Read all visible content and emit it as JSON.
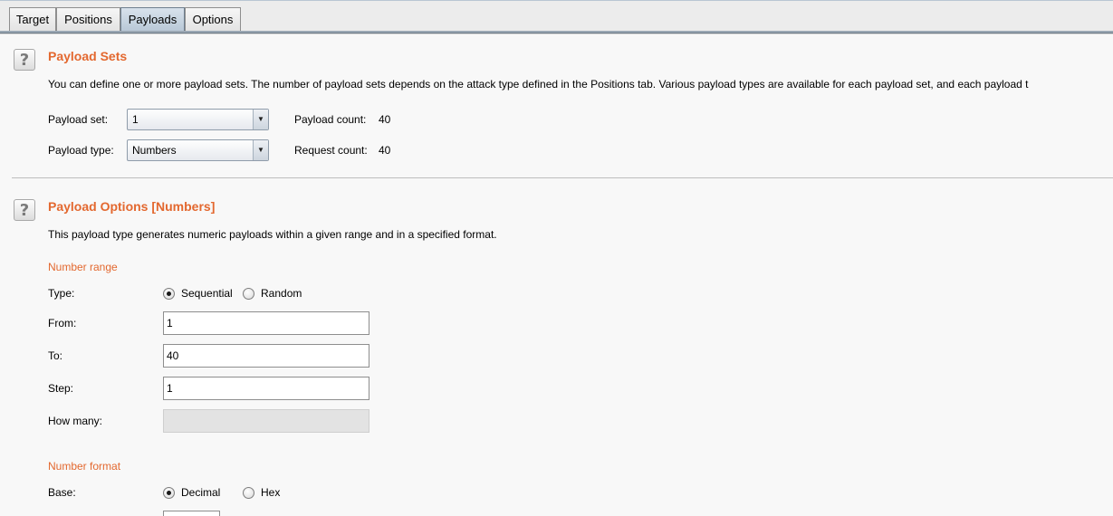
{
  "tabs": [
    {
      "label": "Target",
      "active": false
    },
    {
      "label": "Positions",
      "active": false
    },
    {
      "label": "Payloads",
      "active": true
    },
    {
      "label": "Options",
      "active": false
    }
  ],
  "payload_sets": {
    "title": "Payload Sets",
    "description": "You can define one or more payload sets. The number of payload sets depends on the attack type defined in the Positions tab. Various payload types are available for each payload set, and each payload t",
    "payload_set_label": "Payload set:",
    "payload_set_value": "1",
    "payload_type_label": "Payload type:",
    "payload_type_value": "Numbers",
    "payload_count_label": "Payload count:",
    "payload_count_value": "40",
    "request_count_label": "Request count:",
    "request_count_value": "40",
    "help_icon": "help-icon"
  },
  "payload_options": {
    "title": "Payload Options [Numbers]",
    "description": "This payload type generates numeric payloads within a given range and in a specified format.",
    "number_range": {
      "title": "Number range",
      "type_label": "Type:",
      "type_options": [
        "Sequential",
        "Random"
      ],
      "type_selected": "Sequential",
      "from_label": "From:",
      "from_value": "1",
      "to_label": "To:",
      "to_value": "40",
      "step_label": "Step:",
      "step_value": "1",
      "how_many_label": "How many:",
      "how_many_value": ""
    },
    "number_format": {
      "title": "Number format",
      "base_label": "Base:",
      "base_options": [
        "Decimal",
        "Hex"
      ],
      "base_selected": "Decimal"
    },
    "help_icon": "help-icon"
  },
  "colors": {
    "accent": "#e3682f",
    "active_tab": "#c4d2df"
  }
}
